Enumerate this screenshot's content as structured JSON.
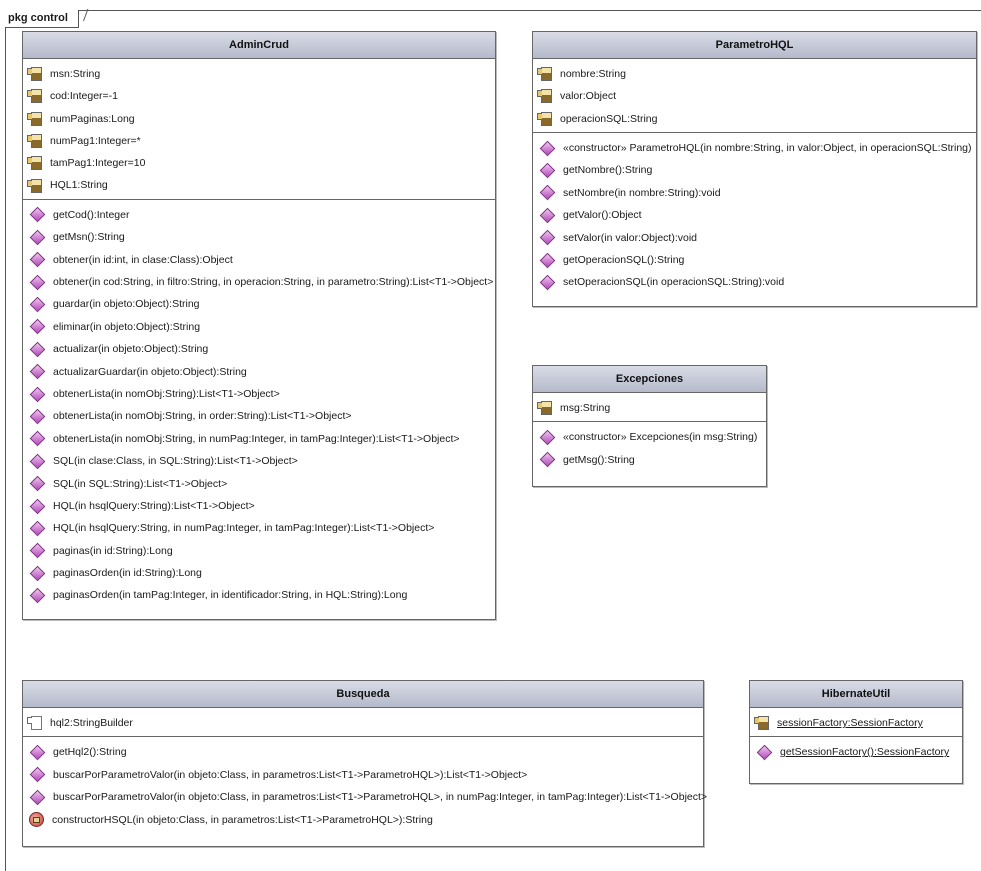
{
  "package": {
    "label": "pkg control"
  },
  "classes": {
    "admincrud": {
      "name": "AdminCrud",
      "attributes": [
        "msn:String",
        "cod:Integer=-1",
        "numPaginas:Long",
        "numPag1:Integer=*",
        "tamPag1:Integer=10",
        "HQL1:String"
      ],
      "operations": [
        "getCod():Integer",
        "getMsn():String",
        "obtener(in id:int, in clase:Class):Object",
        "obtener(in cod:String, in filtro:String, in operacion:String, in parametro:String):List<T1->Object>",
        "guardar(in objeto:Object):String",
        "eliminar(in objeto:Object):String",
        "actualizar(in objeto:Object):String",
        "actualizarGuardar(in objeto:Object):String",
        "obtenerLista(in nomObj:String):List<T1->Object>",
        "obtenerLista(in nomObj:String, in order:String):List<T1->Object>",
        "obtenerLista(in nomObj:String, in numPag:Integer, in tamPag:Integer):List<T1->Object>",
        "SQL(in clase:Class, in SQL:String):List<T1->Object>",
        "SQL(in SQL:String):List<T1->Object>",
        "HQL(in hsqlQuery:String):List<T1->Object>",
        "HQL(in hsqlQuery:String, in numPag:Integer, in tamPag:Integer):List<T1->Object>",
        "paginas(in id:String):Long",
        "paginasOrden(in id:String):Long",
        "paginasOrden(in tamPag:Integer, in identificador:String, in HQL:String):Long"
      ]
    },
    "parametrohql": {
      "name": "ParametroHQL",
      "attributes": [
        "nombre:String",
        "valor:Object",
        "operacionSQL:String"
      ],
      "operations": [
        "«constructor» ParametroHQL(in nombre:String, in valor:Object, in operacionSQL:String)",
        "getNombre():String",
        "setNombre(in nombre:String):void",
        "getValor():Object",
        "setValor(in valor:Object):void",
        "getOperacionSQL():String",
        "setOperacionSQL(in operacionSQL:String):void"
      ]
    },
    "excepciones": {
      "name": "Excepciones",
      "attributes": [
        "msg:String"
      ],
      "operations": [
        "«constructor» Excepciones(in msg:String)",
        "getMsg():String"
      ]
    },
    "busqueda": {
      "name": "Busqueda",
      "attributes": [
        "hql2:StringBuilder"
      ],
      "operations": [
        "getHql2():String",
        "buscarPorParametroValor(in objeto:Class, in parametros:List<T1->ParametroHQL>):List<T1->Object>",
        "buscarPorParametroValor(in objeto:Class, in parametros:List<T1->ParametroHQL>, in numPag:Integer, in tamPag:Integer):List<T1->Object>",
        "constructorHSQL(in objeto:Class, in parametros:List<T1->ParametroHQL>):String"
      ]
    },
    "hibernateutil": {
      "name": "HibernateUtil",
      "attributes": [
        "sessionFactory:SessionFactory"
      ],
      "operations": [
        "getSessionFactory():SessionFactory"
      ]
    }
  }
}
